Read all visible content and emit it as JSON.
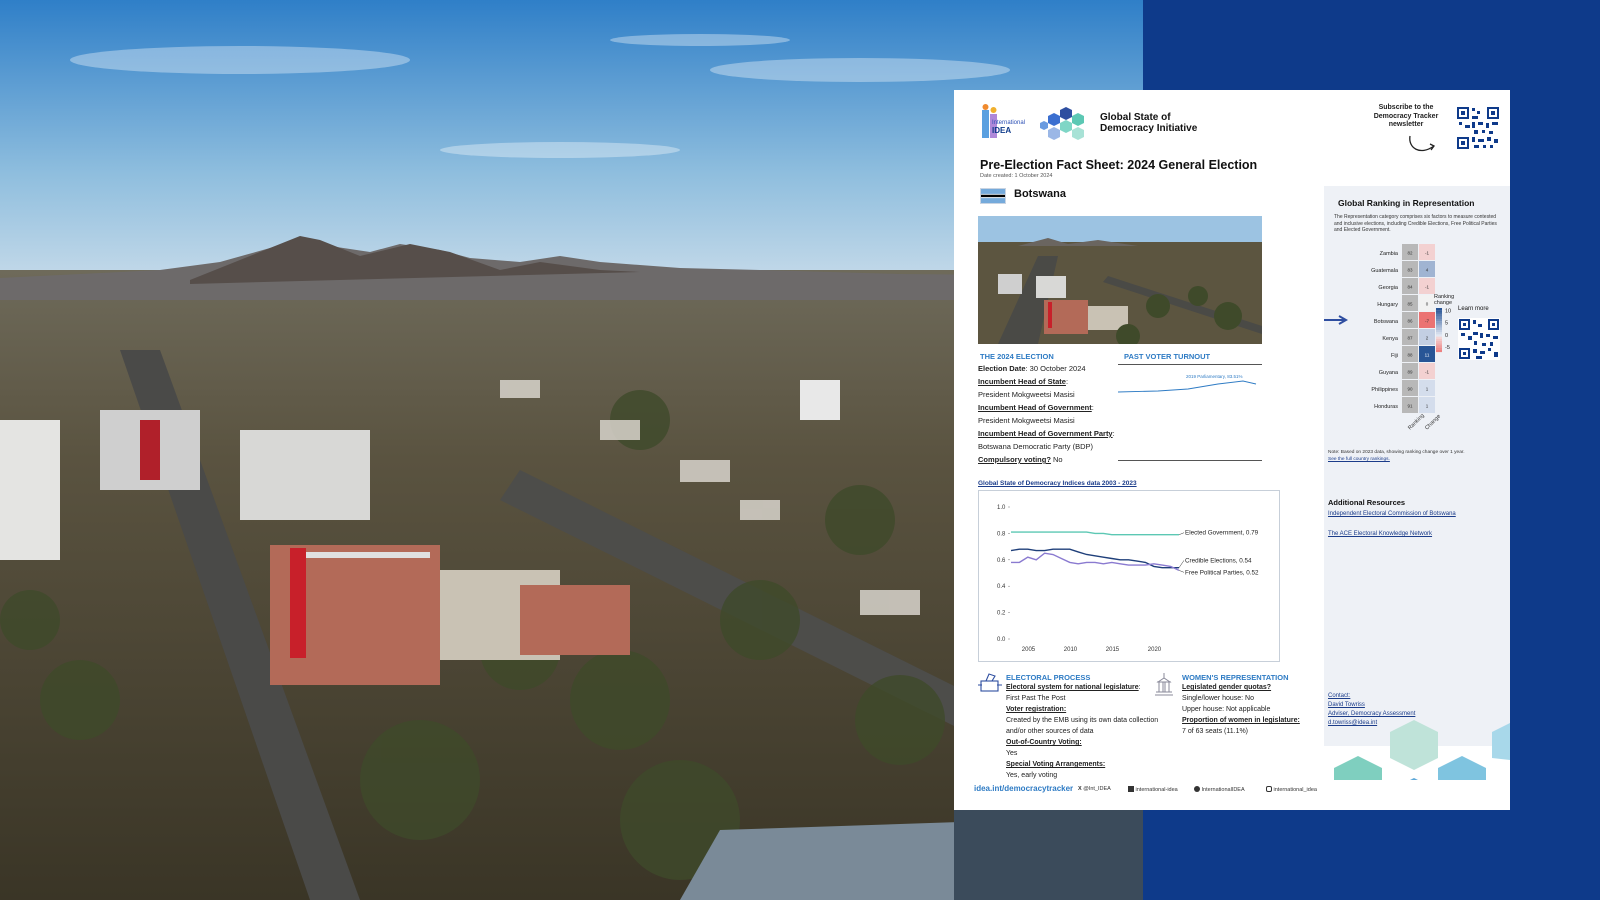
{
  "header": {
    "org_small": "International",
    "org_name": "IDEA",
    "initiative": "Global State of Democracy Initiative",
    "subscribe": "Subscribe to the Democracy Tracker newsletter"
  },
  "sheet": {
    "title": "Pre-Election Fact Sheet: 2024 General Election",
    "date_created": "Date created: 1 October 2024",
    "country": "Botswana"
  },
  "election": {
    "heading": "THE 2024 ELECTION",
    "items": [
      {
        "label": "Election Date",
        "value": ": 30 October 2024",
        "underline": false
      },
      {
        "label": "Incumbent Head of State",
        "value": ":",
        "underline": true
      },
      {
        "label": "",
        "value": "President Mokgweetsi Masisi",
        "underline": false
      },
      {
        "label": "Incumbent Head of Government",
        "value": ":",
        "underline": true
      },
      {
        "label": "",
        "value": "President Mokgweetsi Masisi",
        "underline": false
      },
      {
        "label": "Incumbent Head of Government Party",
        "value": ":",
        "underline": true
      },
      {
        "label": "",
        "value": "Botswana Democratic Party (BDP)",
        "underline": false
      },
      {
        "label": "Compulsory voting?",
        "value": " No",
        "underline": true
      }
    ]
  },
  "turnout": {
    "heading": "PAST VOTER TURNOUT",
    "label": "2019 Parliamentary, 83.51%",
    "series_color": "#2e7bc4"
  },
  "indices": {
    "title": "Global State of Democracy Indices data 2003 - 2023",
    "chart_data": {
      "type": "line",
      "title": "Global State of Democracy Indices data 2003 - 2023",
      "ylim": [
        0.0,
        1.0
      ],
      "yticks": [
        "0.0",
        "0.2",
        "0.4",
        "0.6",
        "0.8",
        "1.0"
      ],
      "xticks": [
        "2005",
        "2010",
        "2015",
        "2020"
      ],
      "x": [
        2003,
        2004,
        2005,
        2006,
        2007,
        2008,
        2009,
        2010,
        2011,
        2012,
        2013,
        2014,
        2015,
        2016,
        2017,
        2018,
        2019,
        2020,
        2021,
        2022,
        2023
      ],
      "series": [
        {
          "name": "Elected Government, 0.79",
          "color": "#5cc8b4",
          "values": [
            0.81,
            0.81,
            0.81,
            0.81,
            0.81,
            0.81,
            0.81,
            0.81,
            0.81,
            0.81,
            0.8,
            0.8,
            0.79,
            0.79,
            0.79,
            0.79,
            0.79,
            0.79,
            0.79,
            0.79,
            0.79
          ]
        },
        {
          "name": "Credible Elections, 0.54",
          "color": "#1f3f7a",
          "values": [
            0.67,
            0.68,
            0.68,
            0.67,
            0.67,
            0.68,
            0.68,
            0.68,
            0.66,
            0.64,
            0.63,
            0.62,
            0.61,
            0.6,
            0.6,
            0.59,
            0.58,
            0.55,
            0.54,
            0.54,
            0.54
          ]
        },
        {
          "name": "Free Political Parties, 0.52",
          "color": "#8a7ad0",
          "values": [
            0.58,
            0.58,
            0.62,
            0.6,
            0.65,
            0.64,
            0.61,
            0.58,
            0.57,
            0.58,
            0.58,
            0.57,
            0.58,
            0.57,
            0.56,
            0.56,
            0.56,
            0.57,
            0.56,
            0.55,
            0.52
          ]
        }
      ]
    }
  },
  "electoral": {
    "heading": "ELECTORAL PROCESS",
    "items": [
      {
        "text": "Electoral system for national legislature",
        "suffix": ":",
        "u": true
      },
      {
        "text": "First Past The Post",
        "suffix": "",
        "u": false
      },
      {
        "text": "Voter registration:",
        "suffix": "",
        "u": true
      },
      {
        "text": "Created by the EMB using its own data collection and/or other sources of data",
        "suffix": "",
        "u": false
      },
      {
        "text": "Out-of-Country Voting:",
        "suffix": "",
        "u": true
      },
      {
        "text": "Yes",
        "suffix": "",
        "u": false
      },
      {
        "text": "Special Voting Arrangements:",
        "suffix": "",
        "u": true
      },
      {
        "text": "Yes, early voting",
        "suffix": "",
        "u": false
      }
    ]
  },
  "women": {
    "heading": "WOMEN'S REPRESENTATION",
    "items": [
      {
        "text": "Legislated gender quotas?",
        "u": true
      },
      {
        "text": "Single/lower house: No",
        "u": false
      },
      {
        "text": "Upper house: Not applicable",
        "u": false
      },
      {
        "text": "Proportion of women in legislature:",
        "u": true
      },
      {
        "text": "7 of 63 seats (11.1%)",
        "u": false
      }
    ]
  },
  "ranking": {
    "title": "Global Ranking in Representation",
    "description": "The Representation category comprises six factors to measure contested and inclusive elections, including Credible Elections, Free Political Parties and Elected Government.",
    "legend_title": "Ranking change",
    "legend_ticks": [
      "10",
      "5",
      "0",
      "-5"
    ],
    "col_labels": [
      "Ranking",
      "Change"
    ],
    "learn_more": "Learn more",
    "note": "Note: Based on 2023 data, showing ranking change over 1 year.",
    "note_link": "See the full country rankings.",
    "chart_data": {
      "type": "heatmap",
      "rows": [
        "Zambia",
        "Guatemala",
        "Georgia",
        "Hungary",
        "Botswana",
        "Kenya",
        "Fiji",
        "Guyana",
        "Philippines",
        "Honduras"
      ],
      "ranking": [
        82,
        83,
        84,
        85,
        86,
        87,
        88,
        89,
        90,
        91
      ],
      "change": [
        -1,
        4,
        -1,
        0,
        -7,
        2,
        11,
        -1,
        1,
        1
      ],
      "highlight": "Botswana"
    }
  },
  "resources": {
    "heading": "Additional Resources",
    "links": [
      "Independent Electoral Commission of Botswana",
      "The ACE Electoral Knowledge Network"
    ]
  },
  "contact": {
    "label": "Contact:",
    "name": "David Towriss",
    "role": "Adviser, Democracy Assessment",
    "email": "d.towriss@idea.int"
  },
  "footer": {
    "url": "idea.int/democracytracker",
    "x": "@Int_IDEA",
    "linkedin": "international-idea",
    "facebook": "InternationalIDEA",
    "instagram": "international_idea"
  },
  "colors": {
    "brand_blue": "#0e3a8a",
    "accent_blue": "#2e7bc4",
    "teal": "#5cc8b4"
  }
}
